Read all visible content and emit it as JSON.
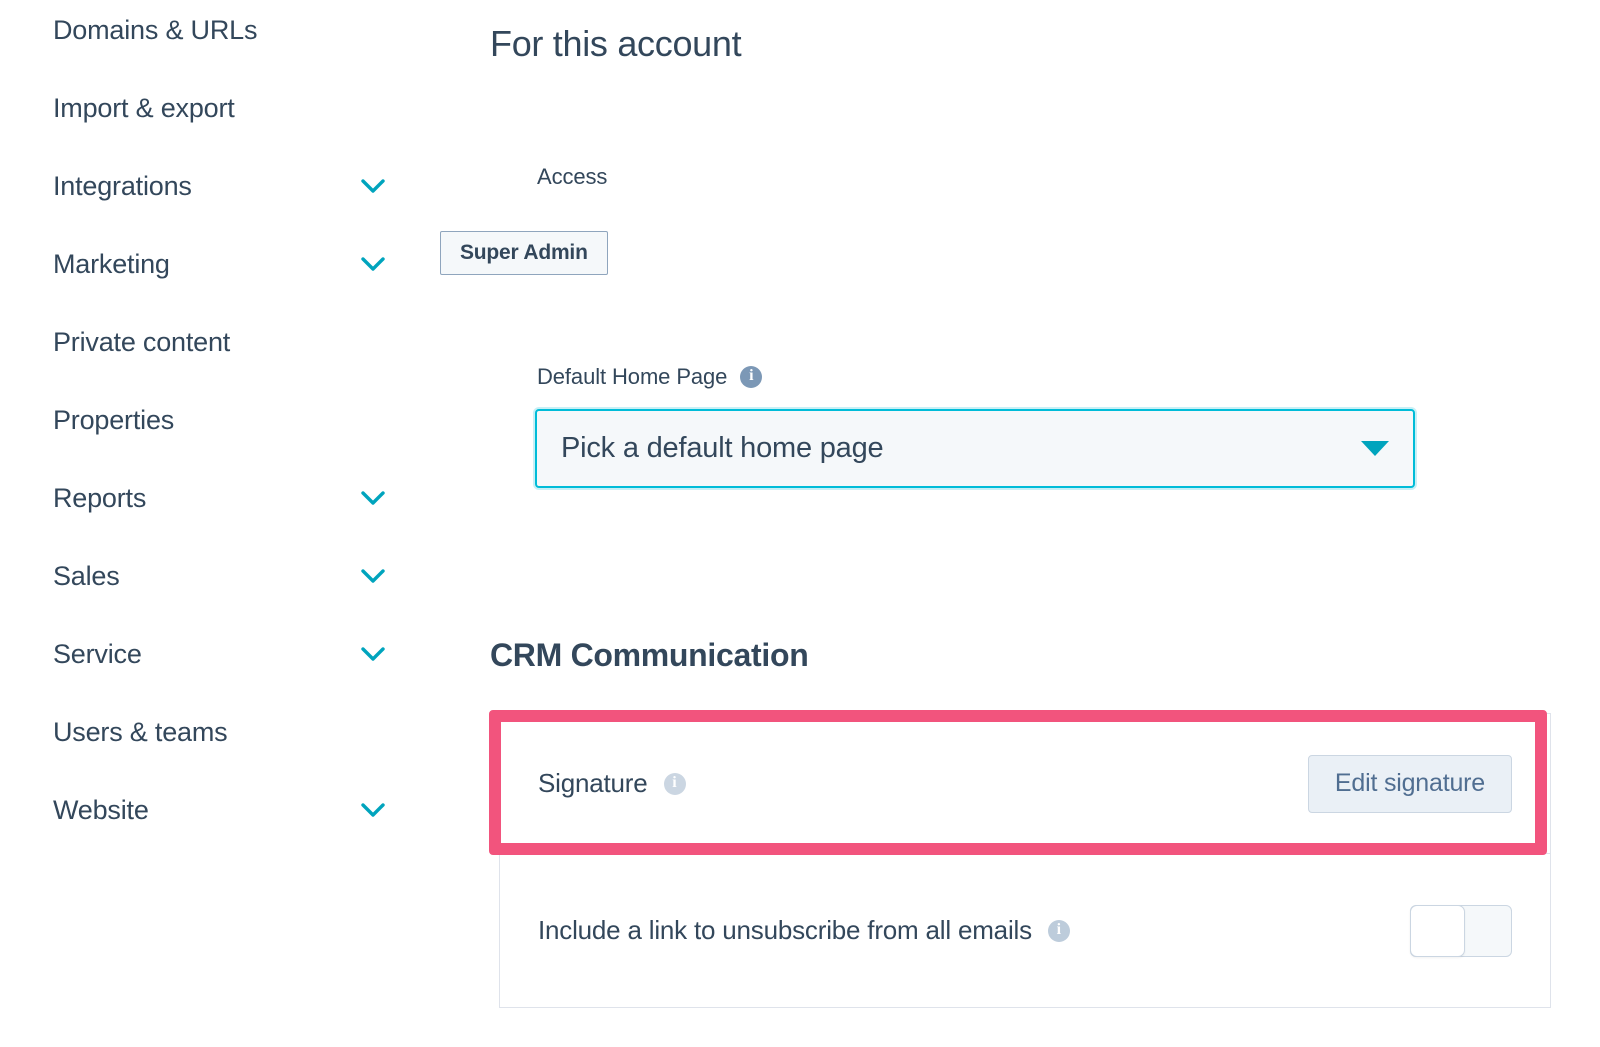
{
  "sidebar": {
    "items": [
      {
        "label": "Domains & URLs",
        "expandable": false
      },
      {
        "label": "Import & export",
        "expandable": false
      },
      {
        "label": "Integrations",
        "expandable": true
      },
      {
        "label": "Marketing",
        "expandable": true
      },
      {
        "label": "Private content",
        "expandable": false
      },
      {
        "label": "Properties",
        "expandable": false
      },
      {
        "label": "Reports",
        "expandable": true
      },
      {
        "label": "Sales",
        "expandable": true
      },
      {
        "label": "Service",
        "expandable": true
      },
      {
        "label": "Users & teams",
        "expandable": false
      },
      {
        "label": "Website",
        "expandable": true
      }
    ]
  },
  "main": {
    "page_title": "For this account",
    "access": {
      "label": "Access",
      "value": "Super Admin"
    },
    "default_home_page": {
      "label": "Default Home Page",
      "info_icon": "info-icon",
      "placeholder": "Pick a default home page",
      "caret_icon": "caret-down-icon"
    },
    "crm_section": {
      "title": "CRM Communication",
      "signature_row": {
        "label": "Signature",
        "info_icon": "info-icon",
        "button_label": "Edit signature"
      },
      "unsubscribe_row": {
        "label": "Include a link to unsubscribe from all emails",
        "info_icon": "info-icon",
        "toggle_state": "off"
      }
    }
  },
  "annotation": {
    "highlight_target": "signature-row",
    "highlight_color": "#f2547d"
  },
  "colors": {
    "text_primary": "#33475b",
    "teal": "#00a4bd",
    "focus_cyan": "#00bcd8",
    "button_bg": "#eaf0f6",
    "card_border": "#dfe3eb",
    "chip_bg": "#f5f8fa"
  }
}
